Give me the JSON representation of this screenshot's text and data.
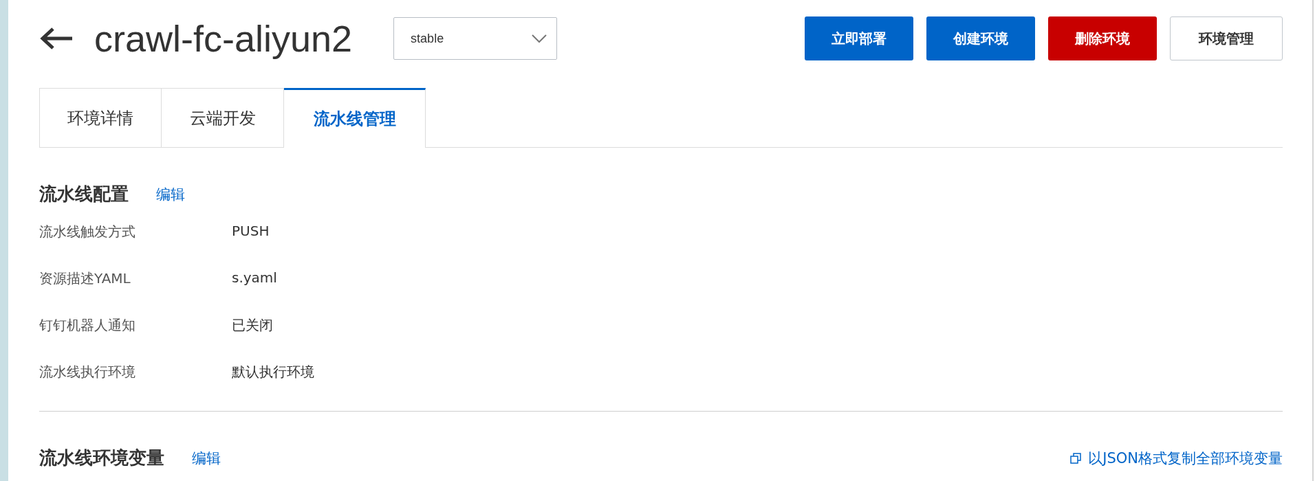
{
  "header": {
    "title": "crawl-fc-aliyun2",
    "environment_select": {
      "value": "stable"
    },
    "buttons": [
      {
        "label": "立即部署",
        "kind": "primary"
      },
      {
        "label": "创建环境",
        "kind": "primary"
      },
      {
        "label": "删除环境",
        "kind": "danger"
      },
      {
        "label": "环境管理",
        "kind": "normal"
      }
    ]
  },
  "tabs": [
    {
      "label": "环境详情",
      "selected": false
    },
    {
      "label": "云端开发",
      "selected": false
    },
    {
      "label": "流水线管理",
      "selected": true
    }
  ],
  "pipeline_config": {
    "title": "流水线配置",
    "edit_link": "编辑",
    "fields": [
      {
        "label": "流水线触发方式",
        "value": "PUSH"
      },
      {
        "label": "资源描述YAML",
        "value": "s.yaml"
      },
      {
        "label": "钉钉机器人通知",
        "value": "已关闭"
      },
      {
        "label": "流水线执行环境",
        "value": "默认执行环境"
      }
    ]
  },
  "pipeline_env_vars": {
    "title": "流水线环境变量",
    "edit_link": "编辑",
    "copy_link": "以JSON格式复制全部环境变量"
  }
}
